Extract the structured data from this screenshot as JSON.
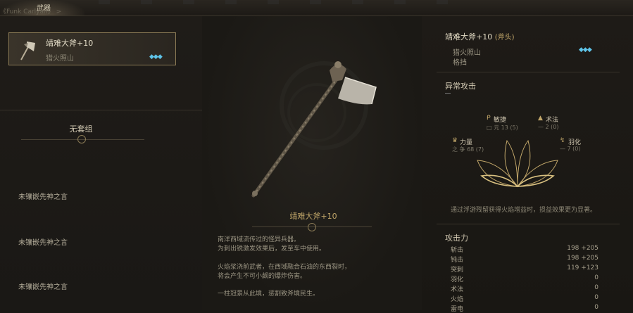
{
  "topbar": {
    "tab_label": "武器",
    "sub_label": "《Funk Carlyan》 >"
  },
  "weapon_card": {
    "name": "靖难大斧+10",
    "sub": "猎火照山",
    "gems": "◆◆◆"
  },
  "set": {
    "title": "无套组"
  },
  "slots": [
    "未镶嵌先神之言",
    "未镶嵌先神之言",
    "未镶嵌先神之言"
  ],
  "center": {
    "title": "靖难大斧+10",
    "desc_lines": [
      "南洋西域流传过的怪异兵器。",
      "为刺出锐激发效果后，发至车中使用。",
      "",
      "火焰浆浇前武者，在西域融合石油的东西裂时，",
      "将会产生不可小觑的爆炸伤害。",
      "",
      "一柱冠景从此境，惩割致斧境民生。"
    ]
  },
  "right": {
    "title": "靖难大斧+10",
    "type": "(斧头)",
    "line1": "猎火照山",
    "line2": "格挡",
    "gems": "◆◆◆",
    "section": "异常攻击",
    "note": "通过浮游残留获得火焰增益时，损益效果更为显著。",
    "attack_title": "攻击力"
  },
  "stats": [
    {
      "icon": "ᑭ",
      "label": "敏捷",
      "value": "□ 元 13 (5)"
    },
    {
      "icon": "▲",
      "label": "术法",
      "value": "— 2 (0)"
    },
    {
      "icon": "♛",
      "label": "力量",
      "value": "之 争 68 (7)"
    },
    {
      "icon": "↯",
      "label": "羽化",
      "value": "— 7 (0)"
    }
  ],
  "attack": [
    {
      "name": "斩击",
      "value": "198 +205"
    },
    {
      "name": "钝击",
      "value": "198 +205"
    },
    {
      "name": "突刺",
      "value": "119 +123"
    },
    {
      "name": "羽化",
      "value": "0"
    },
    {
      "name": "术法",
      "value": "0"
    },
    {
      "name": "火焰",
      "value": "0"
    },
    {
      "name": "雷电",
      "value": "0"
    }
  ],
  "colors": {
    "gold": "#c2a76a",
    "gem": "#5fc4e8",
    "card_border": "#8a7a55"
  }
}
